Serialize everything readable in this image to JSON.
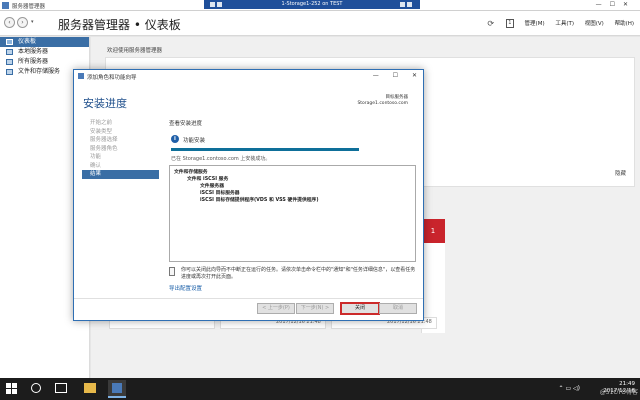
{
  "window": {
    "title": "服务器管理器",
    "remote_session": "1-Storage1-252 on TEST",
    "controls": [
      "—",
      "☐",
      "✕"
    ]
  },
  "header": {
    "title": "服务器管理器 • 仪表板",
    "flag_badge": "1",
    "menu": [
      "管理(M)",
      "工具(T)",
      "视图(V)",
      "帮助(H)"
    ]
  },
  "sidebar": {
    "items": [
      {
        "label": "仪表板",
        "active": true
      },
      {
        "label": "本地服务器",
        "active": false
      },
      {
        "label": "所有服务器",
        "active": false
      },
      {
        "label": "文件和存储服务",
        "active": false
      }
    ]
  },
  "dashboard": {
    "welcome": "欢迎使用服务器管理器",
    "hide": "隐藏",
    "alert_count": "1",
    "tile_times": [
      "2017/12/16 21:48",
      "2017/12/16 21:48"
    ]
  },
  "wizard": {
    "title": "添加角色和功能向导",
    "heading": "安装进度",
    "dest_label": "目标服务器",
    "dest_server": "Storage1.contoso.com",
    "steps": [
      {
        "label": "开始之前",
        "current": false
      },
      {
        "label": "安装类型",
        "current": false
      },
      {
        "label": "服务器选择",
        "current": false
      },
      {
        "label": "服务器角色",
        "current": false
      },
      {
        "label": "功能",
        "current": false
      },
      {
        "label": "确认",
        "current": false
      },
      {
        "label": "结果",
        "current": true
      }
    ],
    "sub_heading": "查看安装进度",
    "info_label": "功能安装",
    "progress_fraction": 1.0,
    "progress_status": "已在 Storage1.contoso.com 上安装成功。",
    "results": [
      "文件和存储服务",
      "文件和 iSCSI 服务",
      "文件服务器",
      "iSCSI 目标服务器",
      "iSCSI 目标存储提供程序(VDS 和 VSS 硬件提供程序)"
    ],
    "note": "你可以关闭此向导而不中断正在运行的任务。请依次单击命令栏中的\"通知\"和\"任务详细信息\"，以查看任务进度或再次打开此页面。",
    "export_link": "导出配置设置",
    "buttons": {
      "prev": "< 上一步(P)",
      "next": "下一步(N) >",
      "close": "关闭",
      "cancel": "取消"
    }
  },
  "taskbar": {
    "time": "21:49",
    "date": "2017/12/16",
    "watermark": "@51CTO博客"
  }
}
